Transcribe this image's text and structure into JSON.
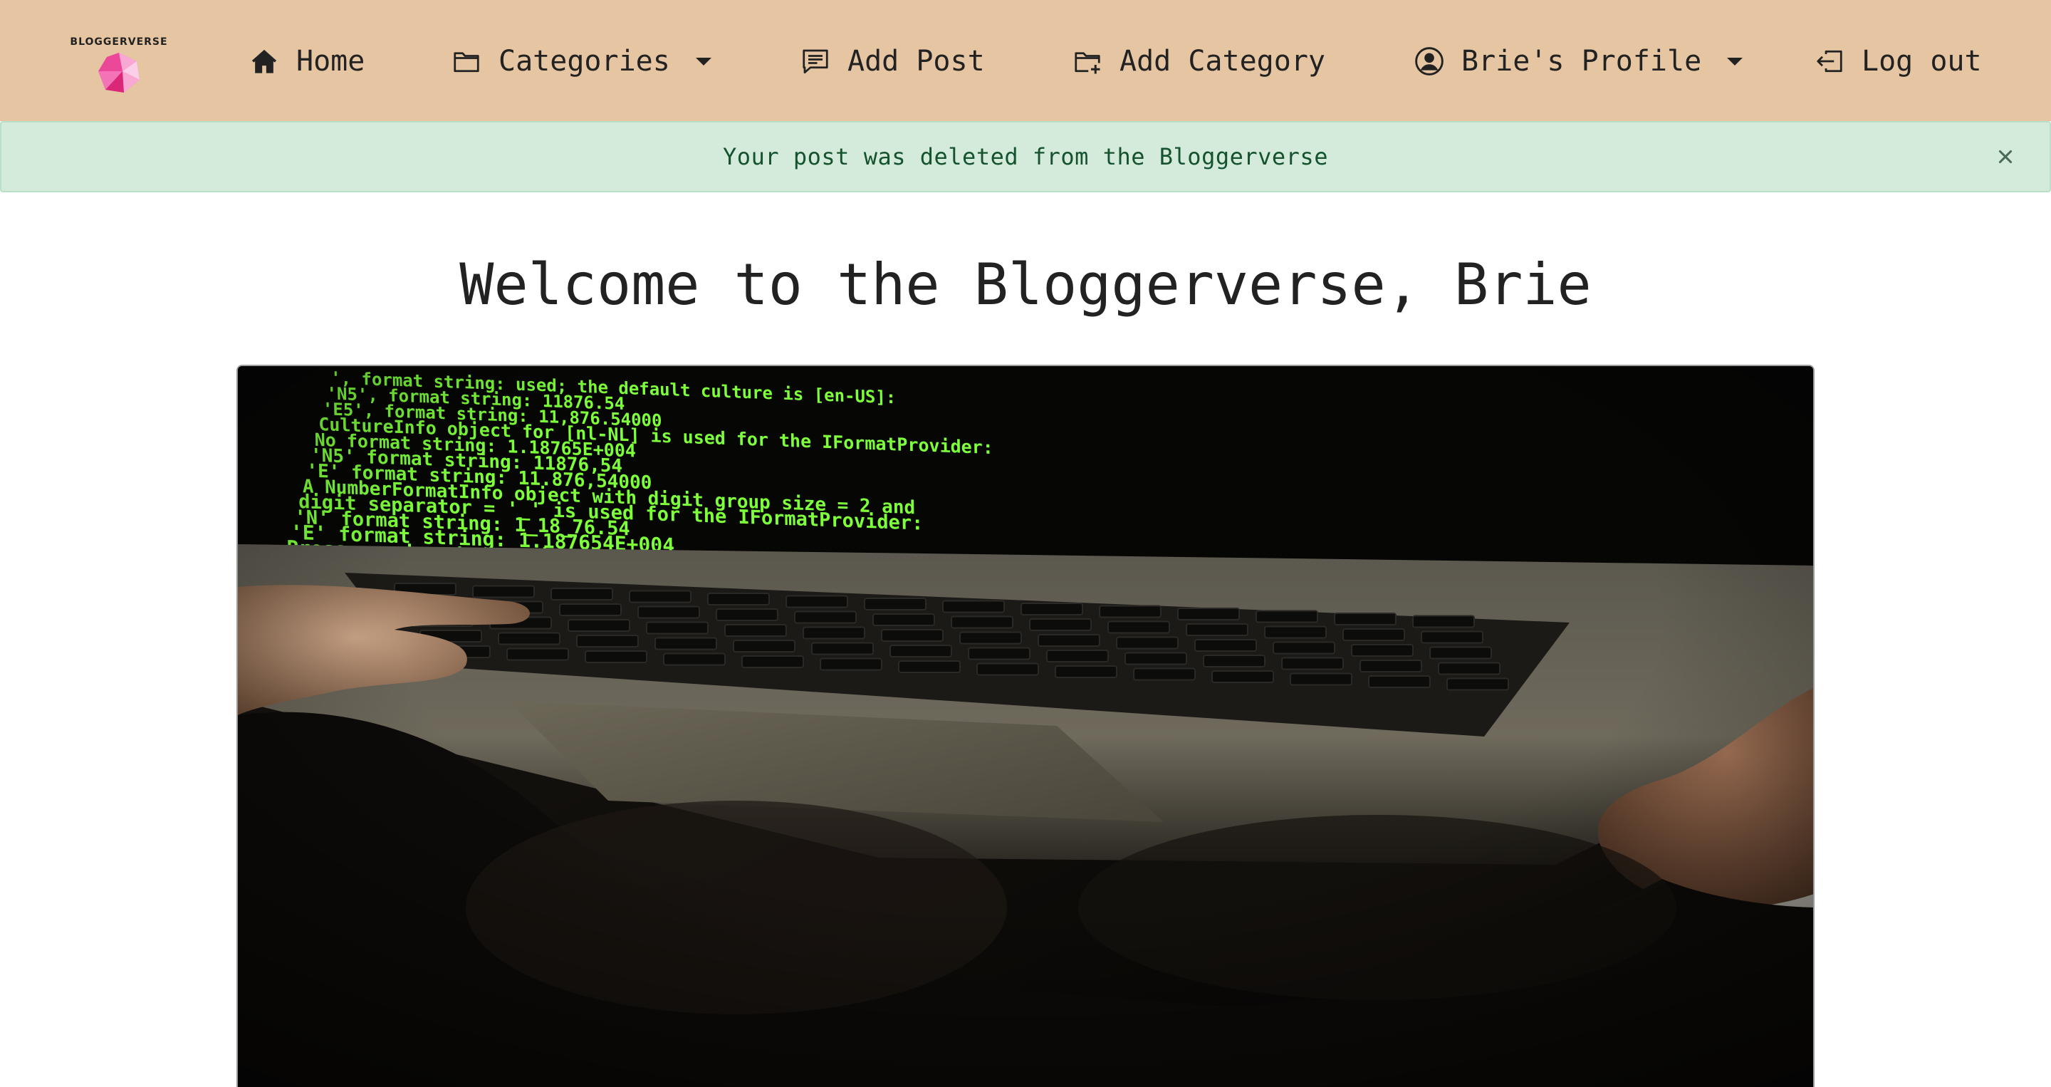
{
  "brand": {
    "name": "BLOGGERVERSE"
  },
  "nav": {
    "home": "Home",
    "categories": "Categories",
    "add_post": "Add Post",
    "add_category": "Add Category",
    "profile": "Brie's Profile",
    "logout": "Log out"
  },
  "alert": {
    "message": "Your post was deleted from the Bloggerverse",
    "close_icon": "close-icon"
  },
  "main": {
    "welcome": "Welcome to the Bloggerverse, Brie"
  },
  "hero": {
    "screen_lines": [
      "', format string:              used; the default culture is [en-US]:",
      "'N5', format string:           11876.54",
      "'E5', format string:           11,876.54000",
      "CultureInfo object for [nl-NL] is used for the IFormatProvider:",
      "No format string:              1.18765E+004",
      "'N5' format string:            11876,54",
      "'E' format string:             11.876,54000",
      "A NumberFormatInfo object with digit group size = 2 and",
      "digit separator = '_' is used for the IFormatProvider:",
      "'N' format string:             1_18_76.54",
      "'E' format string:             1.187654E+004",
      "Press any key to continue . . . _"
    ]
  },
  "colors": {
    "navbar_bg": "#e6c6a2",
    "alert_bg": "#d4ebdc",
    "alert_text": "#14532d",
    "terminal_green": "#7dff3a",
    "gem_pink": "#f26ca7"
  }
}
